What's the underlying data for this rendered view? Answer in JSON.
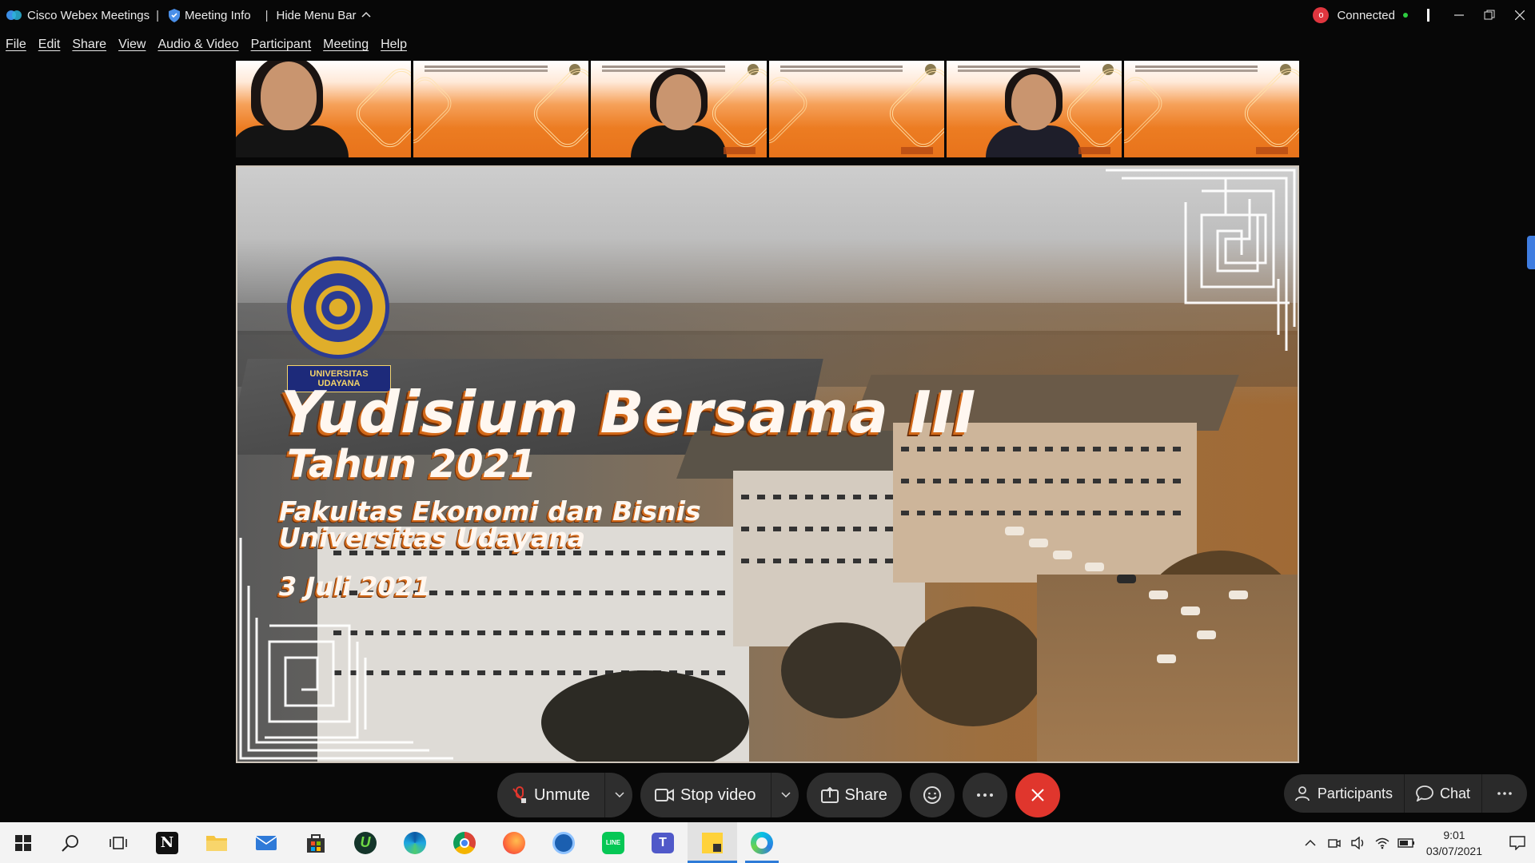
{
  "titlebar": {
    "app_name": "Cisco Webex Meetings",
    "meeting_info": "Meeting Info",
    "hide_menu": "Hide Menu Bar",
    "status": "Connected",
    "rec_label": "o"
  },
  "menu": [
    "File",
    "Edit",
    "Share",
    "View",
    "Audio & Video",
    "Participant",
    "Meeting",
    "Help"
  ],
  "share": {
    "badge": "UNIVERSITAS UDAYANA",
    "title": "Yudisium Bersama III",
    "subtitle": "Tahun 2021",
    "faculty": "Fakultas Ekonomi dan Bisnis",
    "university": "Universitas Udayana",
    "date": "3 Juli 2021"
  },
  "controls": {
    "unmute": "Unmute",
    "stop_video": "Stop video",
    "share": "Share",
    "participants": "Participants",
    "chat": "Chat"
  },
  "taskbar": {
    "time": "9:01",
    "date": "03/07/2021",
    "apps": [
      "start",
      "search",
      "task-view",
      "notion",
      "file-explorer",
      "mail",
      "store",
      "upwork",
      "edge",
      "chrome",
      "firefox",
      "app-circle",
      "line",
      "teams",
      "sticky-notes",
      "webex"
    ]
  },
  "colors": {
    "end_button": "#e0362d",
    "status_green": "#2ecc40",
    "accent_blue": "#2d7bd8"
  }
}
